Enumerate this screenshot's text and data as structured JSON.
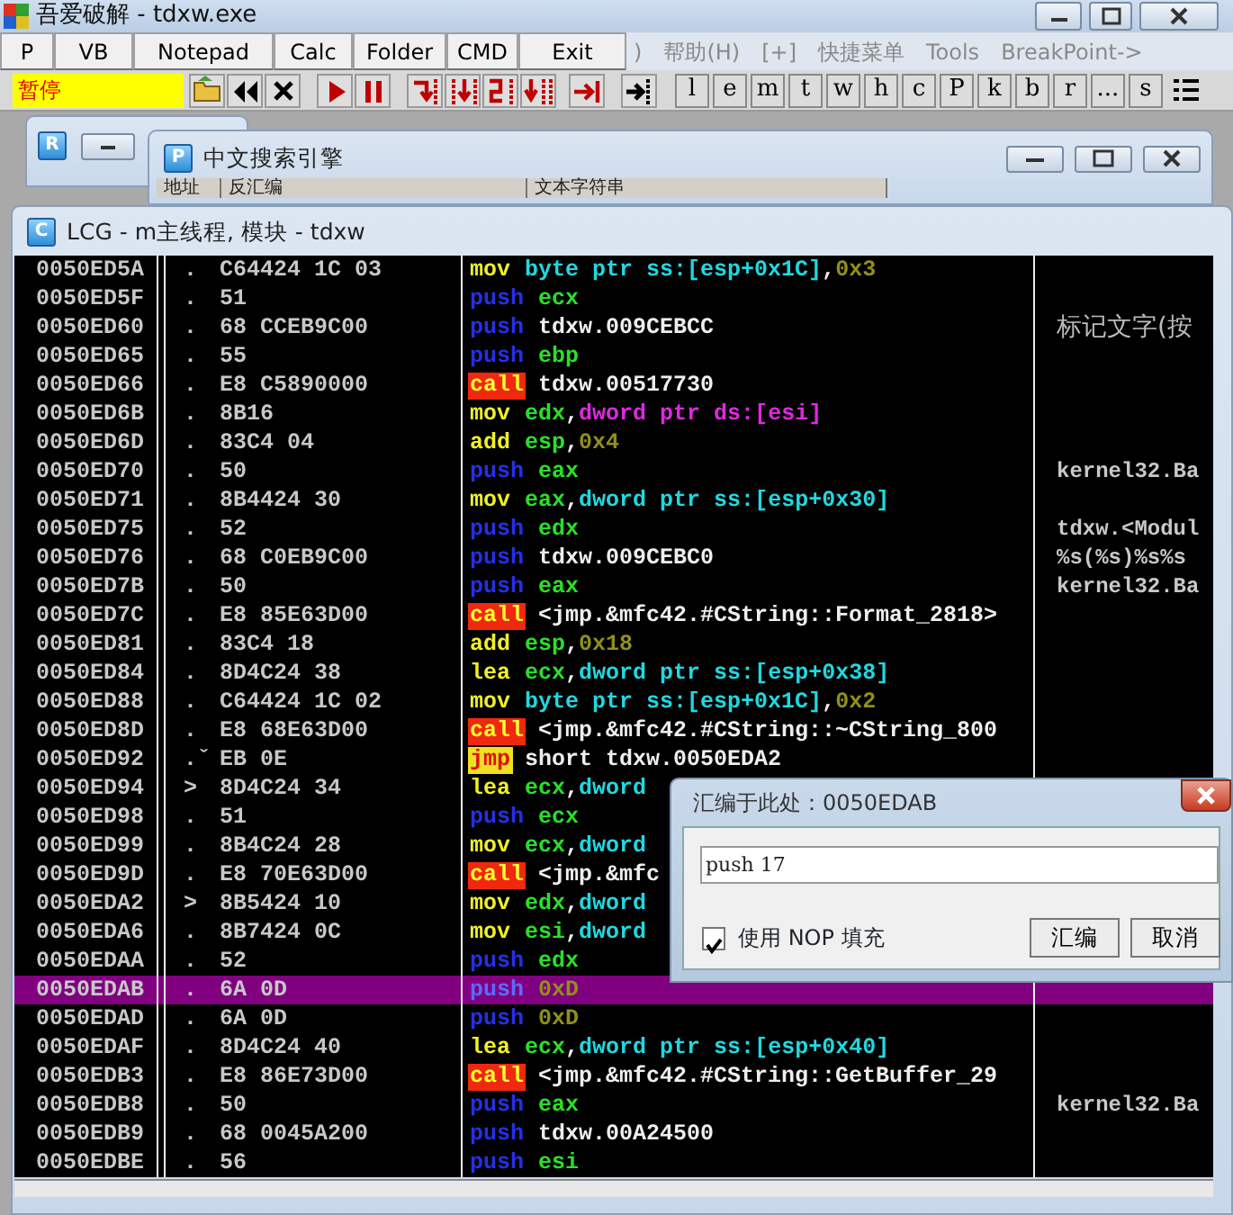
{
  "window": {
    "title": "吾爱破解 - tdxw.exe"
  },
  "quick_buttons": [
    "P",
    "VB",
    "Notepad",
    "Calc",
    "Folder",
    "CMD",
    "Exit"
  ],
  "menu": [
    ")",
    "帮助(H)",
    "[+]",
    "快捷菜单",
    "Tools",
    "BreakPoint->"
  ],
  "status": "暂停",
  "letter_buttons": [
    "l",
    "e",
    "m",
    "t",
    "w",
    "h",
    "c",
    "P",
    "k",
    "b",
    "r",
    "...",
    "s"
  ],
  "child_windows": [
    {
      "badge": "R"
    },
    {
      "badge": "P",
      "title": "中文搜索引擎",
      "columns": [
        "地址",
        "反汇编",
        "文本字符串"
      ]
    },
    {
      "badge": "C",
      "title": "LCG - m主线程, 模块 - tdxw"
    }
  ],
  "listing": {
    "rows": [
      {
        "address": "0050ED5A",
        "marker": ".",
        "hex": "C64424 1C 03",
        "mnemonic": "mov",
        "kind": "plain",
        "operands": [
          {
            "text": "byte ptr ss:[esp+0x1C]",
            "kind": "mem"
          },
          {
            "text": ",",
            "kind": "sep"
          },
          {
            "text": "0x3",
            "kind": "const"
          }
        ],
        "selected": false
      },
      {
        "address": "0050ED5F",
        "marker": ".",
        "hex": "51",
        "mnemonic": "push",
        "kind": "stack",
        "operands": [
          {
            "text": "ecx",
            "kind": "reg"
          }
        ],
        "selected": false
      },
      {
        "address": "0050ED60",
        "marker": ".",
        "hex": "68 CCEB9C00",
        "mnemonic": "push",
        "kind": "stack",
        "operands": [
          {
            "text": "tdxw.009CEBCC",
            "kind": "name"
          }
        ],
        "label": "标记文字(按",
        "selected": false
      },
      {
        "address": "0050ED65",
        "marker": ".",
        "hex": "55",
        "mnemonic": "push",
        "kind": "stack",
        "operands": [
          {
            "text": "ebp",
            "kind": "reg"
          }
        ],
        "selected": false
      },
      {
        "address": "0050ED66",
        "marker": ".",
        "hex": "E8 C5890000",
        "mnemonic": "call",
        "kind": "call",
        "operands": [
          {
            "text": "tdxw.00517730",
            "kind": "name"
          }
        ],
        "selected": false
      },
      {
        "address": "0050ED6B",
        "marker": ".",
        "hex": "8B16",
        "mnemonic": "mov",
        "kind": "plain",
        "operands": [
          {
            "text": "edx",
            "kind": "reg"
          },
          {
            "text": ",",
            "kind": "sep"
          },
          {
            "text": "dword ptr ds:[esi]",
            "kind": "memds"
          }
        ],
        "selected": false
      },
      {
        "address": "0050ED6D",
        "marker": ".",
        "hex": "83C4 04",
        "mnemonic": "add",
        "kind": "plain",
        "operands": [
          {
            "text": "esp",
            "kind": "reg"
          },
          {
            "text": ",",
            "kind": "sep"
          },
          {
            "text": "0x4",
            "kind": "const"
          }
        ],
        "selected": false
      },
      {
        "address": "0050ED70",
        "marker": ".",
        "hex": "50",
        "mnemonic": "push",
        "kind": "stack",
        "operands": [
          {
            "text": "eax",
            "kind": "reg"
          }
        ],
        "comment": "kernel32.Ba",
        "selected": false
      },
      {
        "address": "0050ED71",
        "marker": ".",
        "hex": "8B4424 30",
        "mnemonic": "mov",
        "kind": "plain",
        "operands": [
          {
            "text": "eax",
            "kind": "reg"
          },
          {
            "text": ",",
            "kind": "sep"
          },
          {
            "text": "dword ptr ss:[esp+0x30]",
            "kind": "mem"
          }
        ],
        "selected": false
      },
      {
        "address": "0050ED75",
        "marker": ".",
        "hex": "52",
        "mnemonic": "push",
        "kind": "stack",
        "operands": [
          {
            "text": "edx",
            "kind": "reg"
          }
        ],
        "comment": "tdxw.<Modul",
        "selected": false
      },
      {
        "address": "0050ED76",
        "marker": ".",
        "hex": "68 C0EB9C00",
        "mnemonic": "push",
        "kind": "stack",
        "operands": [
          {
            "text": "tdxw.009CEBC0",
            "kind": "name"
          }
        ],
        "comment": "%s(%s)%s%s",
        "selected": false
      },
      {
        "address": "0050ED7B",
        "marker": ".",
        "hex": "50",
        "mnemonic": "push",
        "kind": "stack",
        "operands": [
          {
            "text": "eax",
            "kind": "reg"
          }
        ],
        "comment": "kernel32.Ba",
        "selected": false
      },
      {
        "address": "0050ED7C",
        "marker": ".",
        "hex": "E8 85E63D00",
        "mnemonic": "call",
        "kind": "call",
        "operands": [
          {
            "text": "<jmp.&mfc42.#CString::Format_2818>",
            "kind": "name"
          }
        ],
        "selected": false
      },
      {
        "address": "0050ED81",
        "marker": ".",
        "hex": "83C4 18",
        "mnemonic": "add",
        "kind": "plain",
        "operands": [
          {
            "text": "esp",
            "kind": "reg"
          },
          {
            "text": ",",
            "kind": "sep"
          },
          {
            "text": "0x18",
            "kind": "const"
          }
        ],
        "selected": false
      },
      {
        "address": "0050ED84",
        "marker": ".",
        "hex": "8D4C24 38",
        "mnemonic": "lea",
        "kind": "plain",
        "operands": [
          {
            "text": "ecx",
            "kind": "reg"
          },
          {
            "text": ",",
            "kind": "sep"
          },
          {
            "text": "dword ptr ss:[esp+0x38]",
            "kind": "mem"
          }
        ],
        "selected": false
      },
      {
        "address": "0050ED88",
        "marker": ".",
        "hex": "C64424 1C 02",
        "mnemonic": "mov",
        "kind": "plain",
        "operands": [
          {
            "text": "byte ptr ss:[esp+0x1C]",
            "kind": "mem"
          },
          {
            "text": ",",
            "kind": "sep"
          },
          {
            "text": "0x2",
            "kind": "const"
          }
        ],
        "selected": false
      },
      {
        "address": "0050ED8D",
        "marker": ".",
        "hex": "E8 68E63D00",
        "mnemonic": "call",
        "kind": "call",
        "operands": [
          {
            "text": "<jmp.&mfc42.#CString::~CString_800",
            "kind": "name"
          }
        ],
        "selected": false
      },
      {
        "address": "0050ED92",
        "marker": ".ˇ",
        "hex": "EB 0E",
        "mnemonic": "jmp",
        "kind": "jump",
        "operands": [
          {
            "text": "short tdxw.0050EDA2",
            "kind": "name"
          }
        ],
        "selected": false
      },
      {
        "address": "0050ED94",
        "marker": ">",
        "hex": "8D4C24 34",
        "mnemonic": "lea",
        "kind": "plain",
        "operands": [
          {
            "text": "ecx",
            "kind": "reg"
          },
          {
            "text": ",",
            "kind": "sep"
          },
          {
            "text": "dword",
            "kind": "mem"
          }
        ],
        "selected": false
      },
      {
        "address": "0050ED98",
        "marker": ".",
        "hex": "51",
        "mnemonic": "push",
        "kind": "stack",
        "operands": [
          {
            "text": "ecx",
            "kind": "reg"
          }
        ],
        "selected": false
      },
      {
        "address": "0050ED99",
        "marker": ".",
        "hex": "8B4C24 28",
        "mnemonic": "mov",
        "kind": "plain",
        "operands": [
          {
            "text": "ecx",
            "kind": "reg"
          },
          {
            "text": ",",
            "kind": "sep"
          },
          {
            "text": "dword",
            "kind": "mem"
          }
        ],
        "selected": false
      },
      {
        "address": "0050ED9D",
        "marker": ".",
        "hex": "E8 70E63D00",
        "mnemonic": "call",
        "kind": "call",
        "operands": [
          {
            "text": "<jmp.&mfc",
            "kind": "name"
          }
        ],
        "selected": false
      },
      {
        "address": "0050EDA2",
        "marker": ">",
        "hex": "8B5424 10",
        "mnemonic": "mov",
        "kind": "plain",
        "operands": [
          {
            "text": "edx",
            "kind": "reg"
          },
          {
            "text": ",",
            "kind": "sep"
          },
          {
            "text": "dword",
            "kind": "mem"
          }
        ],
        "selected": false
      },
      {
        "address": "0050EDA6",
        "marker": ".",
        "hex": "8B7424 0C",
        "mnemonic": "mov",
        "kind": "plain",
        "operands": [
          {
            "text": "esi",
            "kind": "reg"
          },
          {
            "text": ",",
            "kind": "sep"
          },
          {
            "text": "dword",
            "kind": "mem"
          }
        ],
        "selected": false
      },
      {
        "address": "0050EDAA",
        "marker": ".",
        "hex": "52",
        "mnemonic": "push",
        "kind": "stack",
        "operands": [
          {
            "text": "edx",
            "kind": "reg"
          }
        ],
        "selected": false
      },
      {
        "address": "0050EDAB",
        "marker": ".",
        "hex": "6A 0D",
        "mnemonic": "push",
        "kind": "stack",
        "operands": [
          {
            "text": "0xD",
            "kind": "const"
          }
        ],
        "selected": true
      },
      {
        "address": "0050EDAD",
        "marker": ".",
        "hex": "6A 0D",
        "mnemonic": "push",
        "kind": "stack",
        "operands": [
          {
            "text": "0xD",
            "kind": "const"
          }
        ],
        "selected": false
      },
      {
        "address": "0050EDAF",
        "marker": ".",
        "hex": "8D4C24 40",
        "mnemonic": "lea",
        "kind": "plain",
        "operands": [
          {
            "text": "ecx",
            "kind": "reg"
          },
          {
            "text": ",",
            "kind": "sep"
          },
          {
            "text": "dword ptr ss:[esp+0x40]",
            "kind": "mem"
          }
        ],
        "selected": false
      },
      {
        "address": "0050EDB3",
        "marker": ".",
        "hex": "E8 86E73D00",
        "mnemonic": "call",
        "kind": "call",
        "operands": [
          {
            "text": "<jmp.&mfc42.#CString::GetBuffer_29",
            "kind": "name"
          }
        ],
        "selected": false
      },
      {
        "address": "0050EDB8",
        "marker": ".",
        "hex": "50",
        "mnemonic": "push",
        "kind": "stack",
        "operands": [
          {
            "text": "eax",
            "kind": "reg"
          }
        ],
        "comment": "kernel32.Ba",
        "selected": false
      },
      {
        "address": "0050EDB9",
        "marker": ".",
        "hex": "68 0045A200",
        "mnemonic": "push",
        "kind": "stack",
        "operands": [
          {
            "text": "tdxw.00A24500",
            "kind": "name"
          }
        ],
        "selected": false
      },
      {
        "address": "0050EDBE",
        "marker": ".",
        "hex": "56",
        "mnemonic": "push",
        "kind": "stack",
        "operands": [
          {
            "text": "esi",
            "kind": "reg"
          }
        ],
        "selected": false
      }
    ]
  },
  "dialog": {
    "title": "汇编于此处：0050EDAB",
    "value": "push 17",
    "checkbox": {
      "label": "使用 NOP 填充",
      "checked": true
    },
    "buttons": [
      "汇编",
      "取消"
    ]
  }
}
